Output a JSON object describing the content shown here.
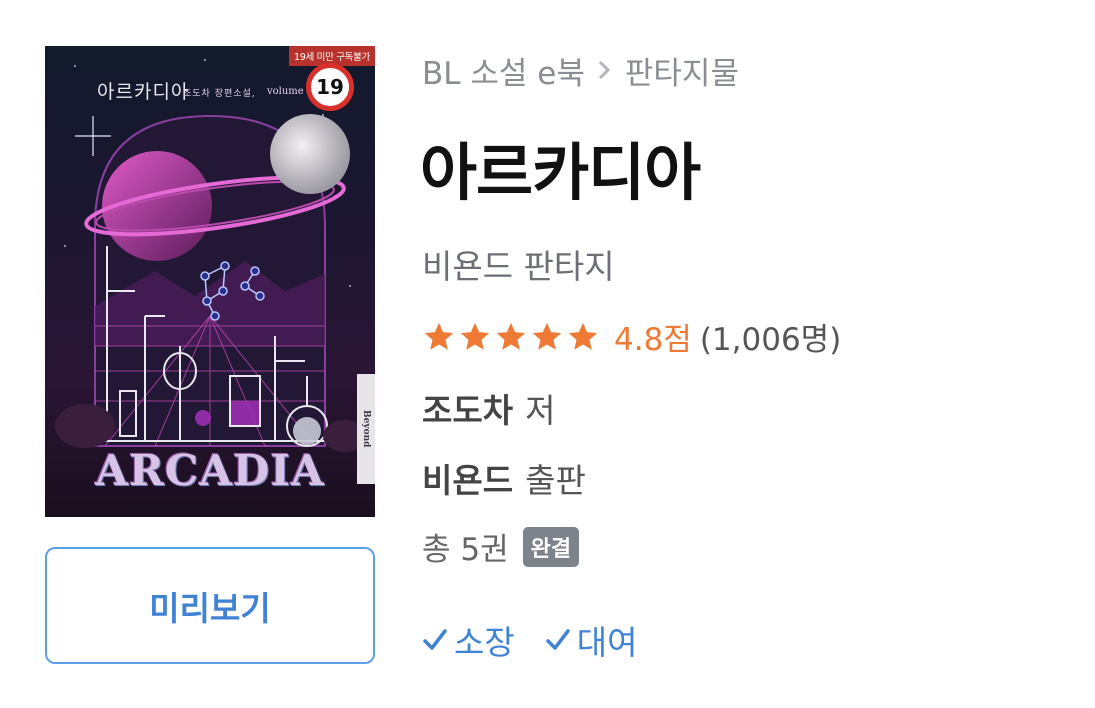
{
  "cover": {
    "title_ko": "아르카디아",
    "subtitle": "조도차 장편소설,",
    "volume": "volume",
    "age_banner": "19세 미만 구독불가",
    "age_badge": "19",
    "publisher_logo": "Beyond",
    "title_en": "ARCADIA"
  },
  "preview_button": {
    "label": "미리보기"
  },
  "breadcrumb": {
    "category": "BL 소설 e북",
    "separator_icon": "chevron-right-icon",
    "subcategory": "판타지물"
  },
  "book": {
    "title": "아르카디아",
    "series": "비욘드 판타지",
    "rating": {
      "stars": 5,
      "star_color": "#ef7a36",
      "score": "4.8점",
      "count": "(1,006명)"
    },
    "author": {
      "name": "조도차",
      "suffix": "저"
    },
    "publisher": {
      "name": "비욘드",
      "suffix": "출판"
    },
    "volumes": {
      "text": "총 5권",
      "status_badge": "완결"
    }
  },
  "actions": [
    {
      "icon": "checkmark-icon",
      "label": "소장"
    },
    {
      "icon": "checkmark-icon",
      "label": "대여"
    }
  ],
  "colors": {
    "accent_blue": "#3f82d6",
    "rating_orange": "#ef7a36",
    "badge_gray": "#7d838a"
  }
}
